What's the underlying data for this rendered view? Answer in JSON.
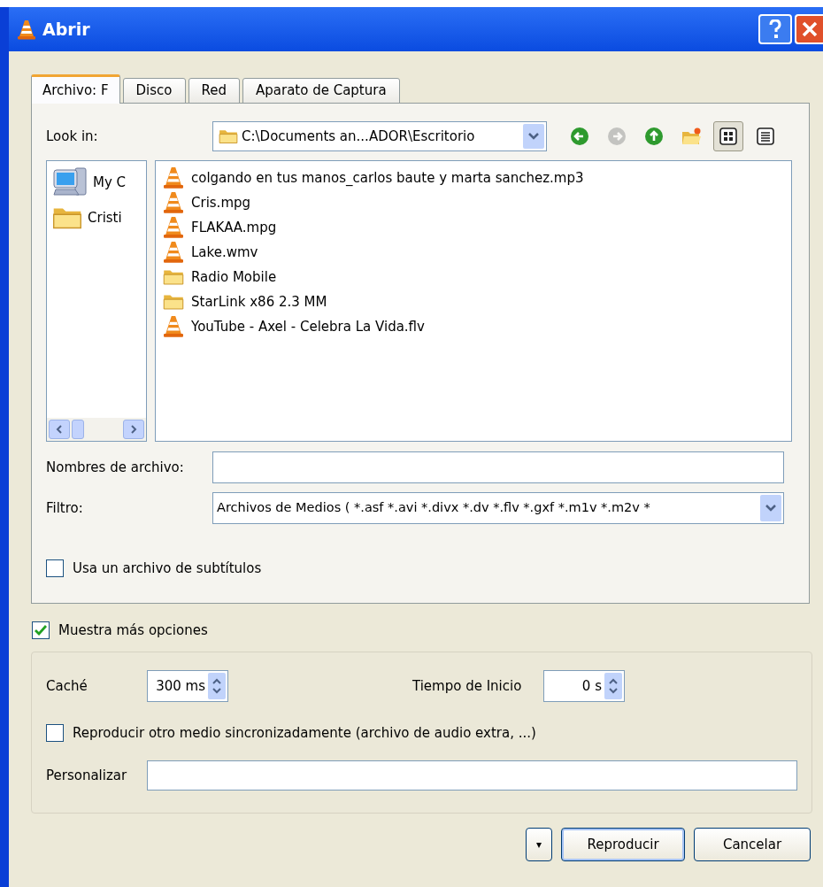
{
  "window": {
    "title": "Abrir"
  },
  "tabs": [
    {
      "label": "Archivo: F",
      "selected": true
    },
    {
      "label": "Disco",
      "selected": false
    },
    {
      "label": "Red",
      "selected": false
    },
    {
      "label": "Aparato de Captura",
      "selected": false
    }
  ],
  "look_in": {
    "label": "Look in:",
    "value": "C:\\Documents an...ADOR\\Escritorio"
  },
  "toolbar": [
    {
      "kind": "back",
      "disabled": false,
      "selected": false
    },
    {
      "kind": "forward",
      "disabled": true,
      "selected": false
    },
    {
      "kind": "up",
      "disabled": false,
      "selected": false
    },
    {
      "kind": "newfolder",
      "disabled": false,
      "selected": false
    },
    {
      "kind": "list",
      "disabled": false,
      "selected": true
    },
    {
      "kind": "detail",
      "disabled": false,
      "selected": false
    }
  ],
  "sidebar": {
    "items": [
      {
        "kind": "computer",
        "label": "My C"
      },
      {
        "kind": "folder",
        "label": "Cristi"
      }
    ]
  },
  "files": [
    {
      "kind": "media",
      "name": "colgando en tus manos_carlos baute y marta sanchez.mp3"
    },
    {
      "kind": "media",
      "name": "Cris.mpg"
    },
    {
      "kind": "media",
      "name": "FLAKAA.mpg"
    },
    {
      "kind": "media",
      "name": "Lake.wmv"
    },
    {
      "kind": "folder",
      "name": "Radio Mobile"
    },
    {
      "kind": "folder",
      "name": "StarLink x86 2.3 MM"
    },
    {
      "kind": "media",
      "name": "YouTube - Axel - Celebra La Vida.flv"
    }
  ],
  "file_name": {
    "label": "Nombres de archivo:"
  },
  "filter": {
    "label": "Filtro:",
    "value": "Archivos de Medios ( *.asf *.avi *.divx *.dv *.flv *.gxf *.m1v *.m2v *"
  },
  "subtitles": {
    "label": "Usa un archivo de subtítulos",
    "checked": false
  },
  "more_options": {
    "label": "Muestra más opciones",
    "checked": true
  },
  "cache": {
    "label": "Caché",
    "value": "300 ms"
  },
  "start_time": {
    "label": "Tiempo de Inicio",
    "value": "0 s"
  },
  "sync": {
    "label": "Reproducir otro medio sincronizadamente (archivo de audio extra, ...)",
    "checked": false
  },
  "custom": {
    "label": "Personalizar"
  },
  "buttons": [
    {
      "kind": "menu",
      "label": "▾"
    },
    {
      "kind": "default",
      "label": "Reproducir"
    },
    {
      "kind": "normal",
      "label": "Cancelar"
    }
  ]
}
